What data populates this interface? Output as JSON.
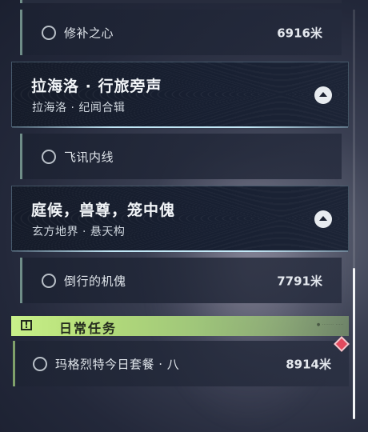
{
  "quest_list": {
    "entries": [
      {
        "type": "quest",
        "name": "修补之心",
        "distance": "6916米"
      },
      {
        "type": "chapter",
        "title": "拉海洛 · 行旅旁声",
        "subtitle": "拉海洛 · 纪闻合辑"
      },
      {
        "type": "quest",
        "name": "飞讯内线",
        "distance": ""
      },
      {
        "type": "chapter",
        "title": "庭候，兽尊，笼中傀",
        "subtitle": "玄方地界 · 悬天构"
      },
      {
        "type": "quest",
        "name": "倒行的机傀",
        "distance": "7791米"
      }
    ]
  },
  "daily": {
    "header_label": "日常任务",
    "header_fine_print": "● ······· ·····",
    "quest": {
      "name": "玛格烈特今日套餐 · 八",
      "distance": "8914米"
    }
  },
  "icons": {
    "quest_status": "circle-outline-icon",
    "chapter_toggle": "chevron-up-icon",
    "daily_badge": "exclamation-box-icon",
    "tracking_marker": "red-diamond-icon"
  },
  "colors": {
    "daily_accent": "#c8f08a",
    "chapter_border": "#b4e6fa",
    "marker": "#e24a5e"
  },
  "scroll": {
    "position_fraction": 0.62,
    "visible_fraction": 0.37
  }
}
